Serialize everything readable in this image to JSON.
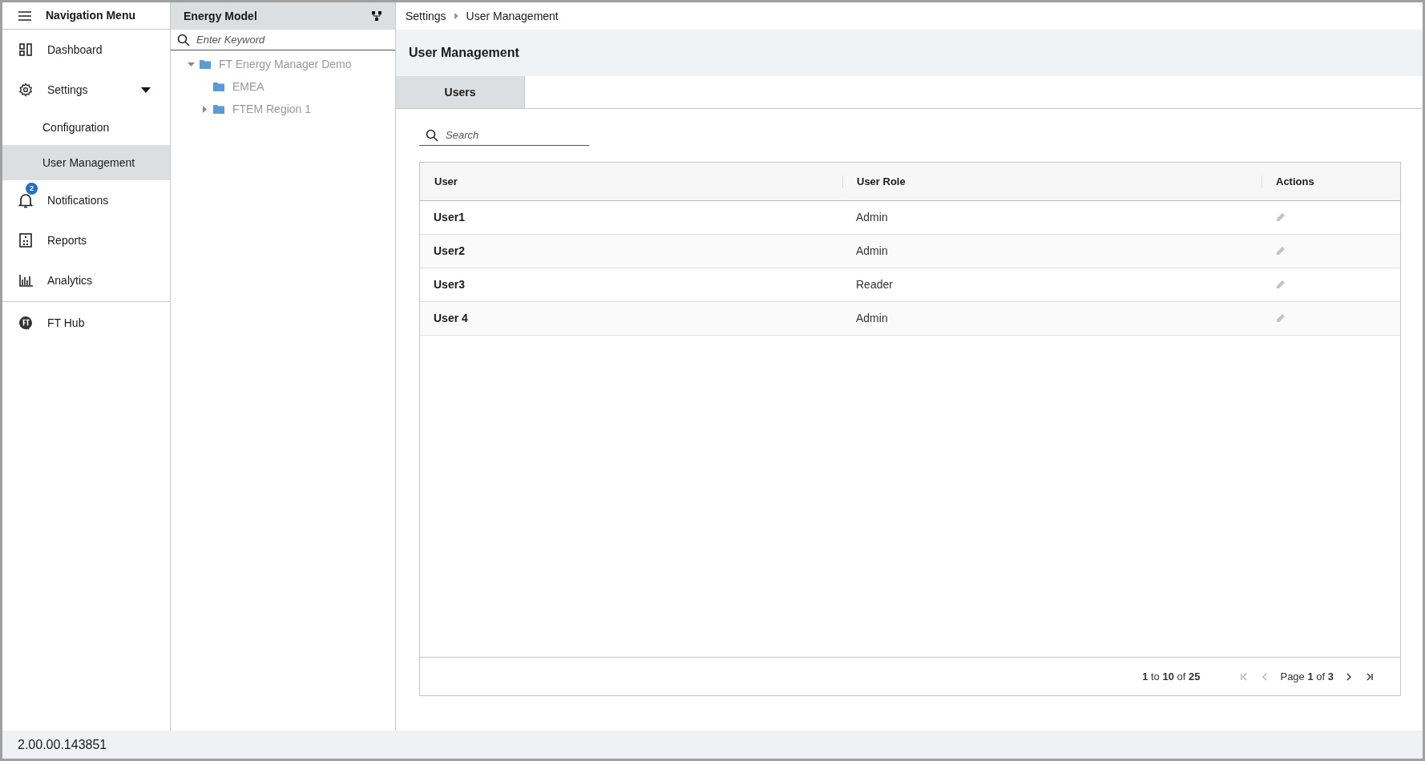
{
  "nav": {
    "title": "Navigation Menu",
    "items": [
      {
        "kind": "item",
        "label": "Dashboard",
        "selected": false
      },
      {
        "kind": "group",
        "label": "Settings",
        "expanded": true,
        "children": [
          {
            "label": "Configuration",
            "selected": false
          },
          {
            "label": "User Management",
            "selected": true
          }
        ]
      },
      {
        "kind": "item",
        "label": "Notifications",
        "badge": "2",
        "selected": false
      },
      {
        "kind": "item",
        "label": "Reports",
        "selected": false
      },
      {
        "kind": "item",
        "label": "Analytics",
        "selected": false
      },
      {
        "kind": "divider"
      },
      {
        "kind": "item",
        "label": "FT Hub",
        "selected": false
      }
    ]
  },
  "tree": {
    "title": "Energy Model",
    "search": {
      "placeholder": "Enter Keyword"
    },
    "nodes": [
      {
        "label": "FT Energy Manager Demo",
        "expanded": true,
        "children": [
          {
            "label": "EMEA"
          },
          {
            "label": "FTEM Region 1",
            "expanded": false
          }
        ]
      }
    ]
  },
  "breadcrumb": [
    "Settings",
    "User Management"
  ],
  "page_title": "User Management",
  "tabs": [
    {
      "label": "Users",
      "selected": true
    }
  ],
  "search": {
    "placeholder": "Search"
  },
  "table": {
    "columns": [
      "User",
      "User Role",
      "Actions"
    ],
    "rows": [
      {
        "user": "User1",
        "role": "Admin"
      },
      {
        "user": "User2",
        "role": "Admin"
      },
      {
        "user": "User3",
        "role": "Reader"
      },
      {
        "user": "User 4",
        "role": "Admin"
      }
    ],
    "range": "**1** to **10** of **25**",
    "page": "Page **1** of **3**"
  },
  "status_bar": {
    "version": "2.00.00.143851"
  }
}
